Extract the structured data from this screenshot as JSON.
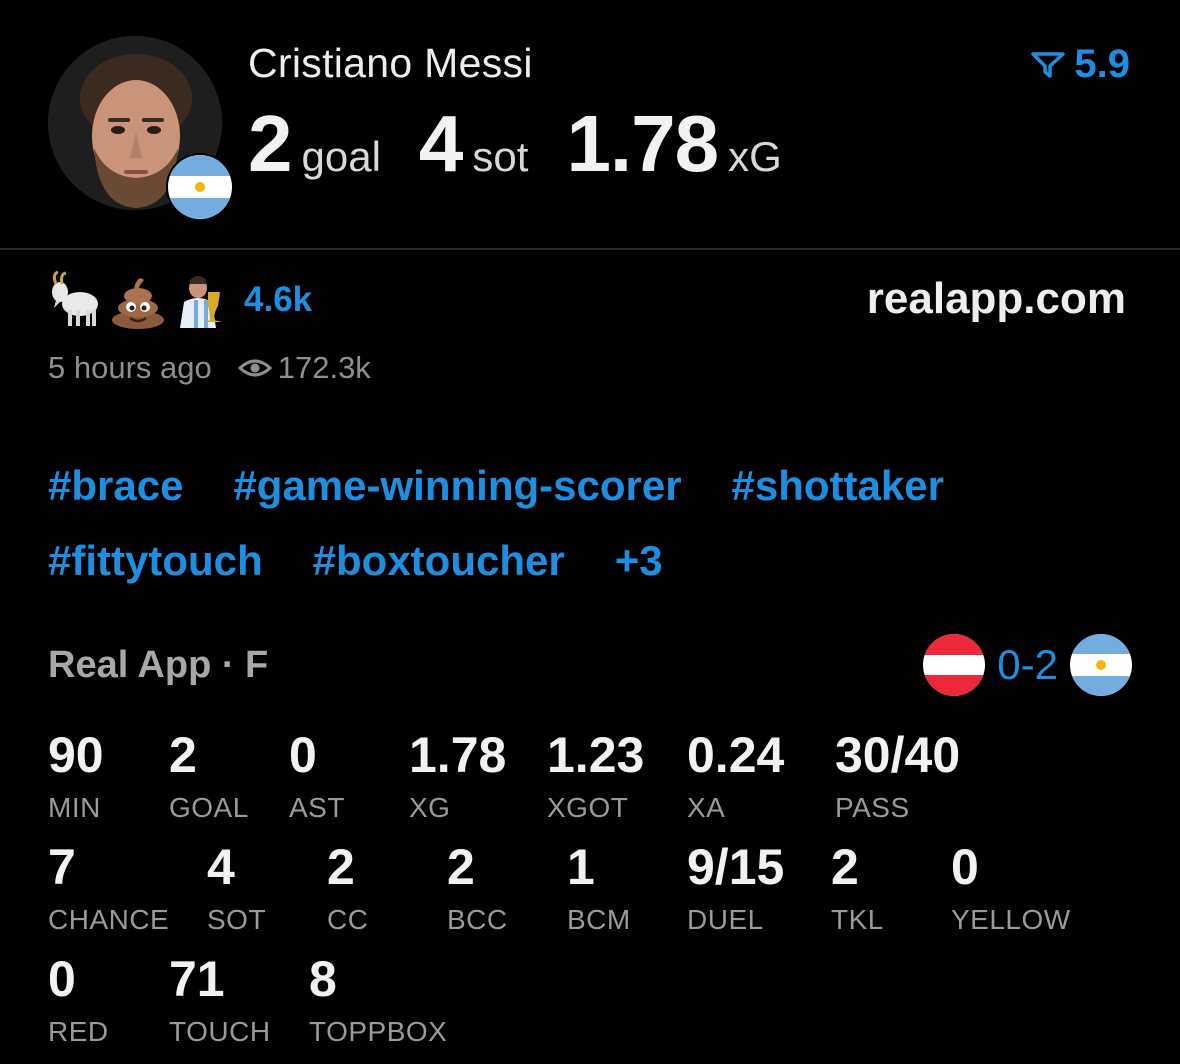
{
  "player": {
    "name": "Cristiano Messi",
    "rating": "5.9",
    "headline": {
      "goal_value": "2",
      "goal_label": "goal",
      "sot_value": "4",
      "sot_label": "sot",
      "xg_value": "1.78",
      "xg_label": "xG"
    }
  },
  "post": {
    "reactions": [
      "goat-emoji",
      "poop-emoji",
      "trophy-kiss-emoji"
    ],
    "reaction_count": "4.6k",
    "site": "realapp.com",
    "time_ago": "5 hours ago",
    "views": "172.3k"
  },
  "tags": {
    "line1": [
      "#brace",
      "#game-winning-scorer",
      "#shottaker"
    ],
    "line2": [
      "#fittytouch",
      "#boxtoucher",
      "+3"
    ]
  },
  "match": {
    "competition": "Real App · F",
    "score": "0-2",
    "home_flag": "austria-flag",
    "away_flag": "argentina-flag"
  },
  "stats": [
    {
      "value": "90",
      "label": "MIN"
    },
    {
      "value": "2",
      "label": "GOAL"
    },
    {
      "value": "0",
      "label": "AST"
    },
    {
      "value": "1.78",
      "label": "XG"
    },
    {
      "value": "1.23",
      "label": "XGOT"
    },
    {
      "value": "0.24",
      "label": "XA"
    },
    {
      "value": "30/40",
      "label": "PASS"
    },
    {
      "value": "7",
      "label": "CHANCE"
    },
    {
      "value": "4",
      "label": "SOT"
    },
    {
      "value": "2",
      "label": "CC"
    },
    {
      "value": "2",
      "label": "BCC"
    },
    {
      "value": "1",
      "label": "BCM"
    },
    {
      "value": "9/15",
      "label": "DUEL"
    },
    {
      "value": "2",
      "label": "TKL"
    },
    {
      "value": "0",
      "label": "YELLOW"
    },
    {
      "value": "0",
      "label": "RED"
    },
    {
      "value": "71",
      "label": "TOUCH"
    },
    {
      "value": "8",
      "label": "TOPPBOX"
    }
  ],
  "colors": {
    "accent": "#1e8fe0",
    "background": "#000000",
    "muted": "#9a9a9a"
  }
}
